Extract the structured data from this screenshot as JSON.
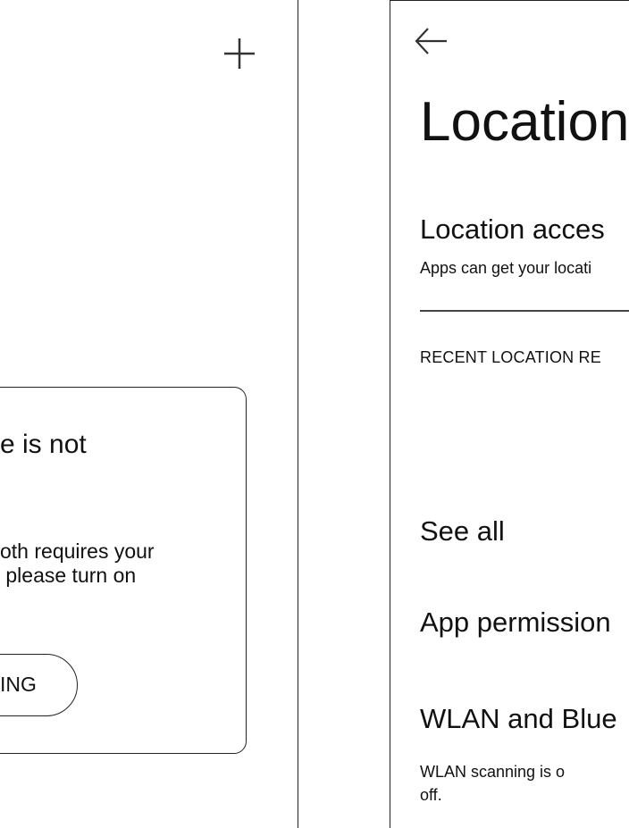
{
  "left": {
    "add_icon": "plus-icon",
    "dialog": {
      "title": "e is not",
      "body_line1": "oth requires your",
      "body_line2": " please turn on",
      "button_label": "ING"
    }
  },
  "right": {
    "back_icon": "arrow-left-icon",
    "title": "Location",
    "location_access": {
      "title": "Location acces",
      "subtitle": "Apps can get your locati"
    },
    "recent_header": "RECENT LOCATION RE",
    "see_all": "See all",
    "app_permissions": "App permission",
    "wlan": {
      "title": "WLAN and Blue",
      "subtitle_line1": "WLAN scanning is o",
      "subtitle_line2": "off."
    }
  }
}
